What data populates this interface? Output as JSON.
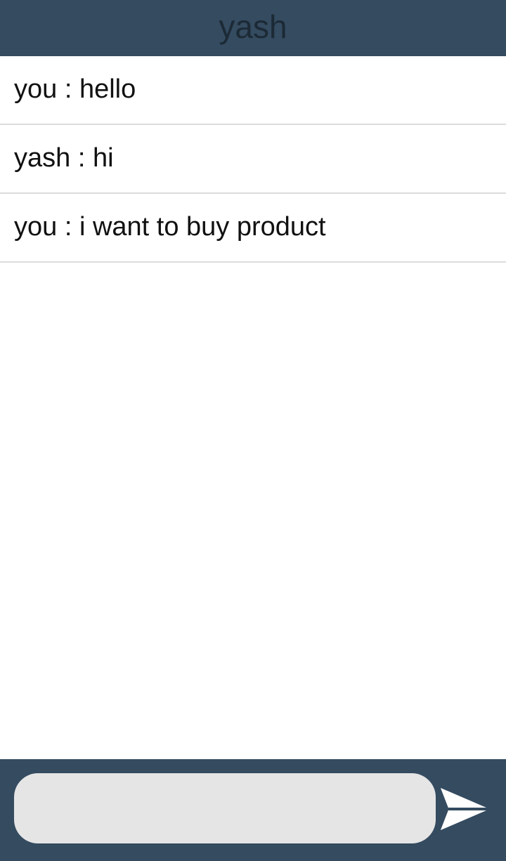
{
  "header": {
    "title": "yash"
  },
  "messages": [
    {
      "text": "you : hello"
    },
    {
      "text": "yash : hi"
    },
    {
      "text": "you : i want to buy product"
    }
  ],
  "composer": {
    "value": "",
    "placeholder": "",
    "send_icon": "send-arrow-icon"
  },
  "colors": {
    "bar_background": "#344b60",
    "header_text": "#1c2a36",
    "input_background": "#e5e5e5",
    "send_icon": "#ffffff"
  }
}
